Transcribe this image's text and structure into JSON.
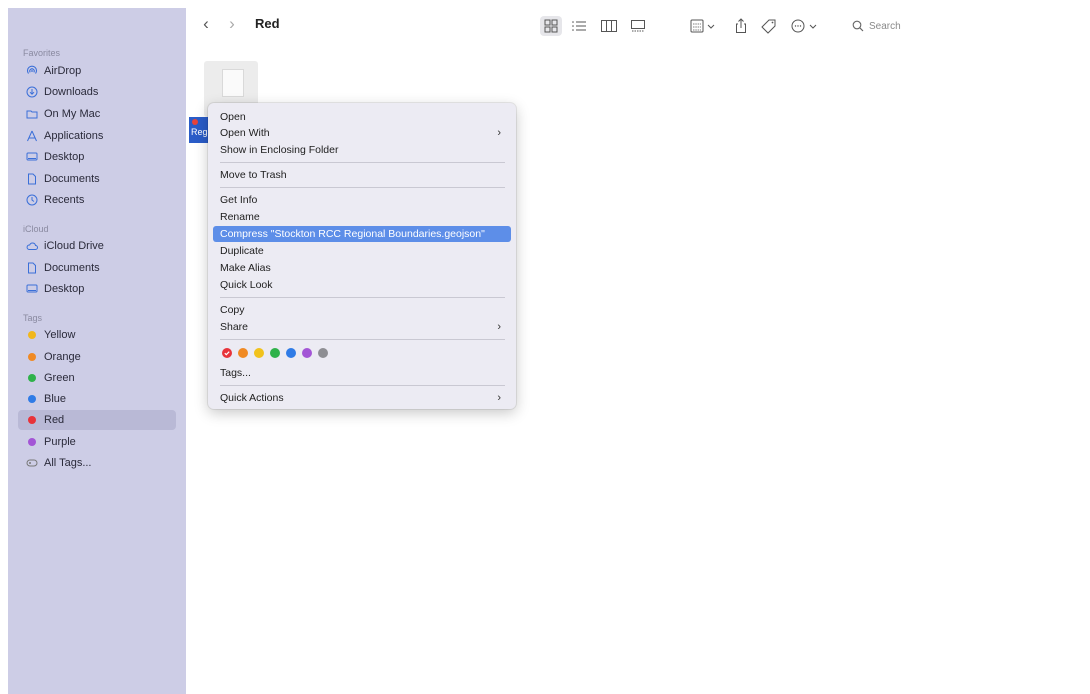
{
  "window": {
    "folder_title": "Red"
  },
  "toolbar": {
    "back": "‹",
    "forward": "›",
    "search_placeholder": "Search"
  },
  "sidebar": {
    "favorites_header": "Favorites",
    "favorites": [
      {
        "label": "AirDrop",
        "icon": "airdrop-icon"
      },
      {
        "label": "Downloads",
        "icon": "downloads-icon"
      },
      {
        "label": "On My Mac",
        "icon": "folder-icon"
      },
      {
        "label": "Applications",
        "icon": "applications-icon"
      },
      {
        "label": "Desktop",
        "icon": "desktop-icon"
      },
      {
        "label": "Documents",
        "icon": "document-icon"
      },
      {
        "label": "Recents",
        "icon": "clock-icon"
      }
    ],
    "icloud_header": "iCloud",
    "icloud": [
      {
        "label": "iCloud Drive",
        "icon": "cloud-icon"
      },
      {
        "label": "Documents",
        "icon": "document-icon"
      },
      {
        "label": "Desktop",
        "icon": "desktop-icon"
      }
    ],
    "tags_header": "Tags",
    "tags": [
      {
        "label": "Yellow",
        "color": "#f1b71c"
      },
      {
        "label": "Orange",
        "color": "#f08a24"
      },
      {
        "label": "Green",
        "color": "#2fb24a"
      },
      {
        "label": "Blue",
        "color": "#2f7be6"
      },
      {
        "label": "Red",
        "color": "#e8333a"
      },
      {
        "label": "Purple",
        "color": "#a355d6"
      }
    ],
    "all_tags": "All Tags...",
    "selected": "Red"
  },
  "file": {
    "label_fragment": "Reg"
  },
  "context_menu": {
    "open": "Open",
    "open_with": "Open With",
    "show_enclosing": "Show in Enclosing Folder",
    "move_to_trash": "Move to Trash",
    "get_info": "Get Info",
    "rename": "Rename",
    "compress": "Compress \"Stockton RCC Regional Boundaries.geojson\"",
    "duplicate": "Duplicate",
    "make_alias": "Make Alias",
    "quick_look": "Quick Look",
    "copy": "Copy",
    "share": "Share",
    "tags": "Tags...",
    "quick_actions": "Quick Actions",
    "submenu_arrow": "›",
    "tag_colors": [
      "#e8333a",
      "#f08a24",
      "#f1c21c",
      "#2fb24a",
      "#2f7be6",
      "#a355d6",
      "#8e8e93"
    ]
  }
}
